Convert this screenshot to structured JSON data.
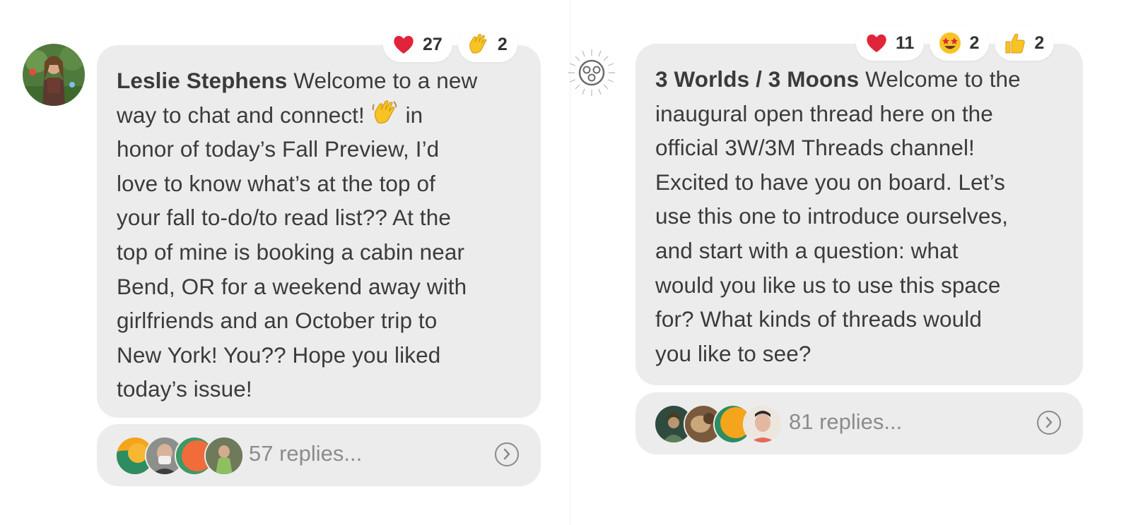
{
  "posts": [
    {
      "author": "Leslie Stephens",
      "lines": [
        " Welcome to a new",
        "way to chat and connect! ",
        "honor of today’s Fall Preview, I’d",
        "love to know what’s at the top of",
        "your fall to-do/to read list?? At the",
        "top of mine is booking a cabin near",
        "Bend, OR for a weekend away with",
        "girlfriends and an October trip to",
        "New York! You?? Hope you liked",
        "today’s issue!"
      ],
      "line2_suffix": " in",
      "reactions": [
        {
          "icon": "red-heart-icon",
          "count": "27"
        },
        {
          "icon": "waving-hand-icon",
          "count": "2"
        }
      ],
      "replies_label": "57 replies..."
    },
    {
      "author": "3 Worlds / 3 Moons",
      "lines": [
        " Welcome to the",
        "inaugural open thread here on the",
        "official 3W/3M Threads channel!",
        "Excited to have you on board. Let’s",
        "use this one to introduce ourselves,",
        "and start with a question: what",
        "would you like us to use this space",
        "for? What kinds of threads would",
        "you like to see?"
      ],
      "reactions": [
        {
          "icon": "red-heart-icon",
          "count": "11"
        },
        {
          "icon": "star-struck-icon",
          "count": "2"
        },
        {
          "icon": "thumbs-up-icon",
          "count": "2"
        }
      ],
      "replies_label": "81 replies..."
    }
  ],
  "colors": {
    "bubble": "#ececec",
    "text": "#3b3b3b",
    "muted": "#8c8c8c",
    "heart": "#e0243a",
    "emoji_yellow": "#f7c325"
  }
}
